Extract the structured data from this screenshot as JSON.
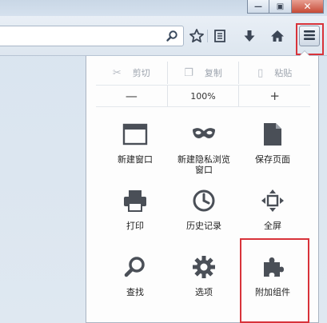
{
  "toolbar": {
    "search_icon": "magnifier-icon",
    "bookmark_star_icon": "star-icon",
    "bookmarks_list_icon": "bookmark-list-icon",
    "download_icon": "download-arrow-icon",
    "home_icon": "home-icon",
    "menu_icon": "hamburger-icon"
  },
  "window_controls": {
    "minimize": "—",
    "maximize": "▣",
    "close": "✕"
  },
  "menu_panel": {
    "edit_row": {
      "cut": "剪切",
      "copy": "复制",
      "paste": "粘贴"
    },
    "zoom_row": {
      "zoom_out": "—",
      "zoom_level": "100%",
      "zoom_in": "+"
    },
    "items": [
      {
        "label": "新建窗口",
        "icon": "new-window-icon"
      },
      {
        "label": "新建隐私浏览\n窗口",
        "icon": "private-mask-icon"
      },
      {
        "label": "保存页面",
        "icon": "save-page-icon"
      },
      {
        "label": "打印",
        "icon": "printer-icon"
      },
      {
        "label": "历史记录",
        "icon": "clock-icon"
      },
      {
        "label": "全屏",
        "icon": "fullscreen-icon"
      },
      {
        "label": "查找",
        "icon": "find-icon"
      },
      {
        "label": "选项",
        "icon": "gear-icon"
      },
      {
        "label": "附加组件",
        "icon": "puzzle-icon"
      }
    ]
  },
  "colors": {
    "highlight": "#d8333a",
    "icon_gray": "#4a4f57"
  }
}
